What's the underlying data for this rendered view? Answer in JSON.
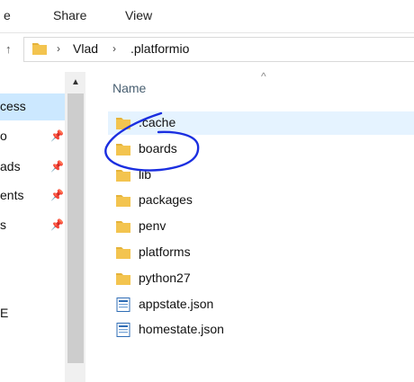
{
  "ribbon": {
    "tabs": [
      "e",
      "Share",
      "View"
    ]
  },
  "address": {
    "up_glyph": "↑",
    "crumbs": [
      "Vlad",
      ".platformio"
    ]
  },
  "nav": {
    "items": [
      {
        "label": "cess",
        "pinned": false,
        "selected": true
      },
      {
        "label": "o",
        "pinned": true
      },
      {
        "label": "ads",
        "pinned": true
      },
      {
        "label": "ents",
        "pinned": true
      },
      {
        "label": "s",
        "pinned": true
      },
      {
        "label": "E",
        "pinned": false
      }
    ]
  },
  "list": {
    "column_header": "Name",
    "sort_glyph": "^",
    "items": [
      {
        "name": ".cache",
        "type": "folder",
        "selected": true
      },
      {
        "name": "boards",
        "type": "folder"
      },
      {
        "name": "lib",
        "type": "folder"
      },
      {
        "name": "packages",
        "type": "folder"
      },
      {
        "name": "penv",
        "type": "folder"
      },
      {
        "name": "platforms",
        "type": "folder"
      },
      {
        "name": "python27",
        "type": "folder"
      },
      {
        "name": "appstate.json",
        "type": "file"
      },
      {
        "name": "homestate.json",
        "type": "file"
      }
    ]
  },
  "colors": {
    "folder": "#f3c44f",
    "selection": "#cce8ff",
    "annotation": "#1a2ee0"
  }
}
